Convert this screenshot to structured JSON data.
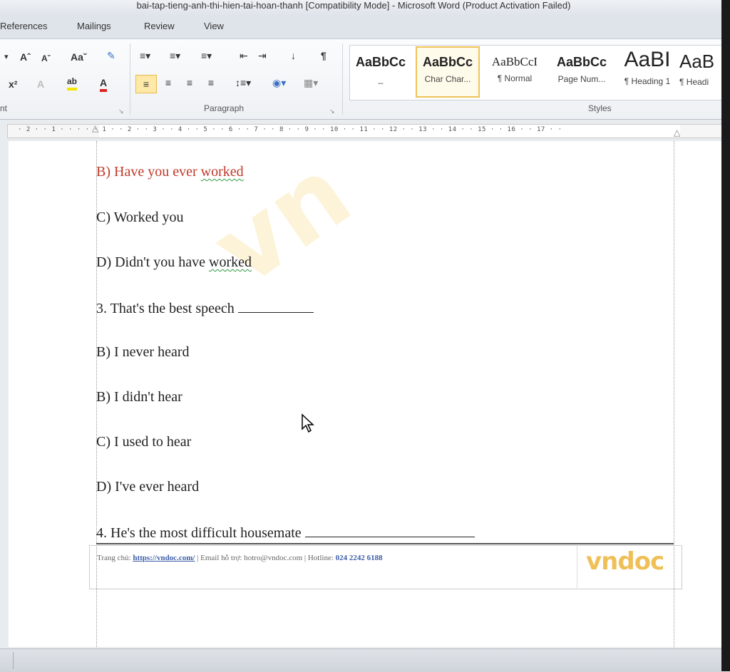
{
  "window": {
    "title": "bai-tap-tieng-anh-thi-hien-tai-hoan-thanh [Compatibility Mode] - Microsoft Word (Product Activation Failed)"
  },
  "ribbon": {
    "tabs": [
      "References",
      "Mailings",
      "Review",
      "View"
    ],
    "groups": {
      "font_partial": "nt",
      "paragraph": "Paragraph",
      "styles": "Styles"
    },
    "font_buttons": {
      "grow": "Aˆ",
      "shrink": "Aˇ",
      "change_case": "Aaˇ",
      "superscript": "x²",
      "highlight": "ab",
      "font_color": "A"
    },
    "styles_gallery": [
      {
        "sample": "AaBbCc",
        "name": "_"
      },
      {
        "sample": "AaBbCc",
        "name": "Char Char..."
      },
      {
        "sample": "AaBbCcI",
        "name": "¶ Normal"
      },
      {
        "sample": "AaBbCc",
        "name": "Page Num..."
      },
      {
        "sample": "AaBI",
        "name": "¶ Heading 1"
      },
      {
        "sample": "AaB",
        "name": "¶ Headi"
      }
    ]
  },
  "ruler": {
    "labels": "· 2 · · 1 · ·   · · · 1 · · 2 · · 3 · · 4 · · 5 · · 6 · · 7 · · 8 · · 9 · · 10 · · 11 · · 12 · · 13 · · 14 · · 15 · · 16 ·   · 17 · ·"
  },
  "document": {
    "lines": [
      {
        "prefix": "B) Have you ever ",
        "word": "worked",
        "highlight": "red"
      },
      {
        "text": "C) Worked you"
      },
      {
        "prefix": "D) Didn't you have ",
        "word": "worked"
      },
      {
        "text": "3. That's the best speech "
      },
      {
        "text": "B) I never heard"
      },
      {
        "text": "B) I didn't hear"
      },
      {
        "text": "C) I used to hear"
      },
      {
        "text": "D) I've ever heard"
      },
      {
        "text": "4. He's the most difficult housemate "
      }
    ]
  },
  "footer": {
    "home_label": "Trang chủ: ",
    "home_link": "https://vndoc.com/",
    "rest": " | Email hỗ trợ: hotro@vndoc.com | Hotline: ",
    "hotline": "024 2242 6188",
    "logo": "vndoc"
  }
}
